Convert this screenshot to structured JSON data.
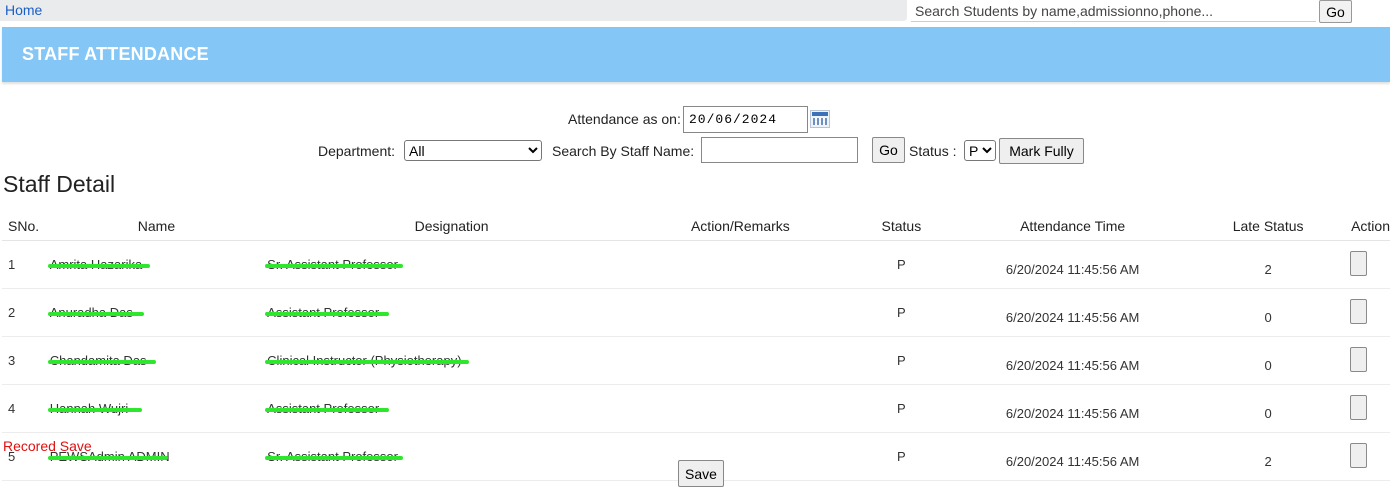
{
  "topbar": {
    "home_label": "Home",
    "search_placeholder": "Search Students by name,admissionno,phone...",
    "go_label": "Go"
  },
  "page": {
    "title": "STAFF ATTENDANCE"
  },
  "filters": {
    "attendance_label": "Attendance as on:",
    "attendance_date": "20/06/2024",
    "calendar_icon": "calendar-icon",
    "department_label": "Department:",
    "department_selected": "All",
    "staff_search_label": "Search By Staff Name:",
    "staff_search_value": "",
    "go_label": "Go",
    "status_label": "Status :",
    "status_selected": "P",
    "mark_fully_label": "Mark Fully"
  },
  "section_title": "Staff Detail",
  "table": {
    "headers": {
      "sno": "SNo.",
      "name": "Name",
      "designation": "Designation",
      "remarks": "Action/Remarks",
      "status": "Status",
      "time": "Attendance Time",
      "late": "Late Status",
      "action": "Action"
    },
    "rows": [
      {
        "sno": "1",
        "name": "Amrita Hazarika",
        "designation": "Sr. Assistant Professor",
        "remarks": "",
        "status": "P",
        "time": "6/20/2024 11:45:56 AM",
        "late": "2"
      },
      {
        "sno": "2",
        "name": "Anuradha Das",
        "designation": "Assistant Professor",
        "remarks": "",
        "status": "P",
        "time": "6/20/2024 11:45:56 AM",
        "late": "0"
      },
      {
        "sno": "3",
        "name": "Chandamita Das",
        "designation": "Clinical Instructor (Physiotherapy)",
        "remarks": "",
        "status": "P",
        "time": "6/20/2024 11:45:56 AM",
        "late": "0"
      },
      {
        "sno": "4",
        "name": "Hannah Wujri",
        "designation": "Assistant Professor",
        "remarks": "",
        "status": "P",
        "time": "6/20/2024 11:45:56 AM",
        "late": "0"
      },
      {
        "sno": "5",
        "name": "PEWSAdmin ADMIN",
        "designation": "Sr. Assistant Professor",
        "remarks": "",
        "status": "P",
        "time": "6/20/2024 11:45:56 AM",
        "late": "2"
      }
    ]
  },
  "status_message": "Recored Save",
  "save_label": "Save",
  "colors": {
    "header_band": "#84c7f7",
    "link": "#1a5fc7",
    "message": "#e01010",
    "redaction": "#2ee62e"
  }
}
